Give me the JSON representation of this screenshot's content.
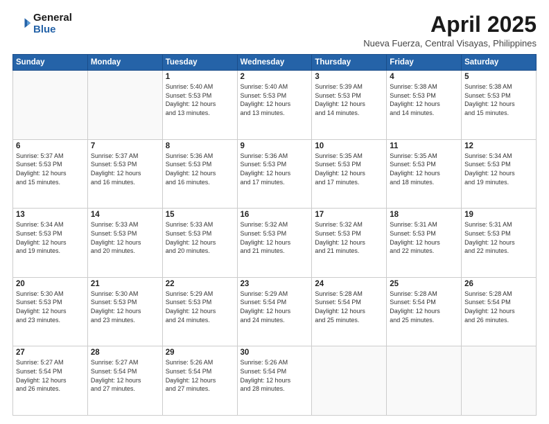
{
  "header": {
    "logo_line1": "General",
    "logo_line2": "Blue",
    "month": "April 2025",
    "location": "Nueva Fuerza, Central Visayas, Philippines"
  },
  "days_of_week": [
    "Sunday",
    "Monday",
    "Tuesday",
    "Wednesday",
    "Thursday",
    "Friday",
    "Saturday"
  ],
  "weeks": [
    [
      {
        "day": "",
        "info": ""
      },
      {
        "day": "",
        "info": ""
      },
      {
        "day": "1",
        "info": "Sunrise: 5:40 AM\nSunset: 5:53 PM\nDaylight: 12 hours\nand 13 minutes."
      },
      {
        "day": "2",
        "info": "Sunrise: 5:40 AM\nSunset: 5:53 PM\nDaylight: 12 hours\nand 13 minutes."
      },
      {
        "day": "3",
        "info": "Sunrise: 5:39 AM\nSunset: 5:53 PM\nDaylight: 12 hours\nand 14 minutes."
      },
      {
        "day": "4",
        "info": "Sunrise: 5:38 AM\nSunset: 5:53 PM\nDaylight: 12 hours\nand 14 minutes."
      },
      {
        "day": "5",
        "info": "Sunrise: 5:38 AM\nSunset: 5:53 PM\nDaylight: 12 hours\nand 15 minutes."
      }
    ],
    [
      {
        "day": "6",
        "info": "Sunrise: 5:37 AM\nSunset: 5:53 PM\nDaylight: 12 hours\nand 15 minutes."
      },
      {
        "day": "7",
        "info": "Sunrise: 5:37 AM\nSunset: 5:53 PM\nDaylight: 12 hours\nand 16 minutes."
      },
      {
        "day": "8",
        "info": "Sunrise: 5:36 AM\nSunset: 5:53 PM\nDaylight: 12 hours\nand 16 minutes."
      },
      {
        "day": "9",
        "info": "Sunrise: 5:36 AM\nSunset: 5:53 PM\nDaylight: 12 hours\nand 17 minutes."
      },
      {
        "day": "10",
        "info": "Sunrise: 5:35 AM\nSunset: 5:53 PM\nDaylight: 12 hours\nand 17 minutes."
      },
      {
        "day": "11",
        "info": "Sunrise: 5:35 AM\nSunset: 5:53 PM\nDaylight: 12 hours\nand 18 minutes."
      },
      {
        "day": "12",
        "info": "Sunrise: 5:34 AM\nSunset: 5:53 PM\nDaylight: 12 hours\nand 19 minutes."
      }
    ],
    [
      {
        "day": "13",
        "info": "Sunrise: 5:34 AM\nSunset: 5:53 PM\nDaylight: 12 hours\nand 19 minutes."
      },
      {
        "day": "14",
        "info": "Sunrise: 5:33 AM\nSunset: 5:53 PM\nDaylight: 12 hours\nand 20 minutes."
      },
      {
        "day": "15",
        "info": "Sunrise: 5:33 AM\nSunset: 5:53 PM\nDaylight: 12 hours\nand 20 minutes."
      },
      {
        "day": "16",
        "info": "Sunrise: 5:32 AM\nSunset: 5:53 PM\nDaylight: 12 hours\nand 21 minutes."
      },
      {
        "day": "17",
        "info": "Sunrise: 5:32 AM\nSunset: 5:53 PM\nDaylight: 12 hours\nand 21 minutes."
      },
      {
        "day": "18",
        "info": "Sunrise: 5:31 AM\nSunset: 5:53 PM\nDaylight: 12 hours\nand 22 minutes."
      },
      {
        "day": "19",
        "info": "Sunrise: 5:31 AM\nSunset: 5:53 PM\nDaylight: 12 hours\nand 22 minutes."
      }
    ],
    [
      {
        "day": "20",
        "info": "Sunrise: 5:30 AM\nSunset: 5:53 PM\nDaylight: 12 hours\nand 23 minutes."
      },
      {
        "day": "21",
        "info": "Sunrise: 5:30 AM\nSunset: 5:53 PM\nDaylight: 12 hours\nand 23 minutes."
      },
      {
        "day": "22",
        "info": "Sunrise: 5:29 AM\nSunset: 5:53 PM\nDaylight: 12 hours\nand 24 minutes."
      },
      {
        "day": "23",
        "info": "Sunrise: 5:29 AM\nSunset: 5:54 PM\nDaylight: 12 hours\nand 24 minutes."
      },
      {
        "day": "24",
        "info": "Sunrise: 5:28 AM\nSunset: 5:54 PM\nDaylight: 12 hours\nand 25 minutes."
      },
      {
        "day": "25",
        "info": "Sunrise: 5:28 AM\nSunset: 5:54 PM\nDaylight: 12 hours\nand 25 minutes."
      },
      {
        "day": "26",
        "info": "Sunrise: 5:28 AM\nSunset: 5:54 PM\nDaylight: 12 hours\nand 26 minutes."
      }
    ],
    [
      {
        "day": "27",
        "info": "Sunrise: 5:27 AM\nSunset: 5:54 PM\nDaylight: 12 hours\nand 26 minutes."
      },
      {
        "day": "28",
        "info": "Sunrise: 5:27 AM\nSunset: 5:54 PM\nDaylight: 12 hours\nand 27 minutes."
      },
      {
        "day": "29",
        "info": "Sunrise: 5:26 AM\nSunset: 5:54 PM\nDaylight: 12 hours\nand 27 minutes."
      },
      {
        "day": "30",
        "info": "Sunrise: 5:26 AM\nSunset: 5:54 PM\nDaylight: 12 hours\nand 28 minutes."
      },
      {
        "day": "",
        "info": ""
      },
      {
        "day": "",
        "info": ""
      },
      {
        "day": "",
        "info": ""
      }
    ]
  ]
}
